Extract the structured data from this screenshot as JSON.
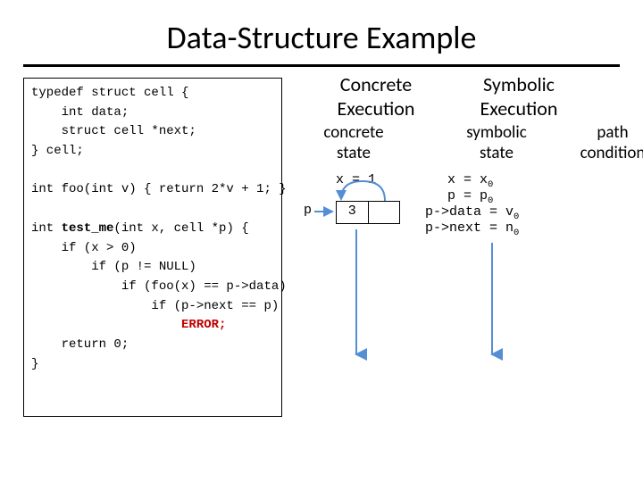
{
  "title": "Data-Structure Example",
  "code": {
    "l1": "typedef struct cell {",
    "l2": "    int data;",
    "l3": "    struct cell *next;",
    "l4": "} cell;",
    "l6": "int foo(int v) { return 2*v + 1; }",
    "l8a": "int ",
    "l8fn": "test_me",
    "l8b": "(int x, cell *p) {",
    "l9": "    if (x > 0)",
    "l10": "        if (p != NULL)",
    "l11": "            if (foo(x) == p->data)",
    "l12": "                if (p->next == p)",
    "l13err": "                    ERROR;",
    "l14": "    return 0;",
    "l15": "}"
  },
  "concrete_header": "Concrete\nExecution",
  "symbolic_header": "Symbolic\nExecution",
  "concrete_sub": "concrete\nstate",
  "symbolic_sub": "symbolic\nstate",
  "path_cond": "path\ncondition",
  "conc_x": "x = 1",
  "p_label": "p",
  "cell_val": "3",
  "sym": {
    "s1a": "x = x",
    "s1b": "0",
    "s2a": "p = p",
    "s2b": "0",
    "s3a": "p->data = v",
    "s3b": "0",
    "s4a": "p->next = n",
    "s4b": "0"
  }
}
